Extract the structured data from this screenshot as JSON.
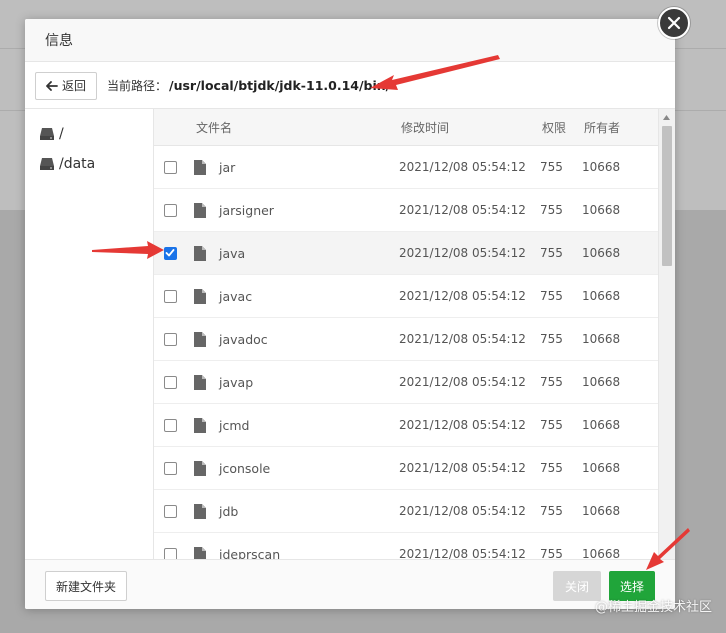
{
  "dialog": {
    "title": "信息"
  },
  "path_bar": {
    "back_label": "返回",
    "current_path_label": "当前路径：",
    "current_path_value": "/usr/local/btjdk/jdk-11.0.14/bin/"
  },
  "sidebar": {
    "drives": [
      {
        "label": "/"
      },
      {
        "label": "/data"
      }
    ]
  },
  "table": {
    "headers": {
      "name": "文件名",
      "modified": "修改时间",
      "permission": "权限",
      "owner": "所有者"
    },
    "rows": [
      {
        "name": "jar",
        "modified": "2021/12/08 05:54:12",
        "permission": "755",
        "owner": "10668",
        "checked": false
      },
      {
        "name": "jarsigner",
        "modified": "2021/12/08 05:54:12",
        "permission": "755",
        "owner": "10668",
        "checked": false
      },
      {
        "name": "java",
        "modified": "2021/12/08 05:54:12",
        "permission": "755",
        "owner": "10668",
        "checked": true
      },
      {
        "name": "javac",
        "modified": "2021/12/08 05:54:12",
        "permission": "755",
        "owner": "10668",
        "checked": false
      },
      {
        "name": "javadoc",
        "modified": "2021/12/08 05:54:12",
        "permission": "755",
        "owner": "10668",
        "checked": false
      },
      {
        "name": "javap",
        "modified": "2021/12/08 05:54:12",
        "permission": "755",
        "owner": "10668",
        "checked": false
      },
      {
        "name": "jcmd",
        "modified": "2021/12/08 05:54:12",
        "permission": "755",
        "owner": "10668",
        "checked": false
      },
      {
        "name": "jconsole",
        "modified": "2021/12/08 05:54:12",
        "permission": "755",
        "owner": "10668",
        "checked": false
      },
      {
        "name": "jdb",
        "modified": "2021/12/08 05:54:12",
        "permission": "755",
        "owner": "10668",
        "checked": false
      },
      {
        "name": "jdeprscan",
        "modified": "2021/12/08 05:54:12",
        "permission": "755",
        "owner": "10668",
        "checked": false
      }
    ]
  },
  "footer": {
    "new_folder_label": "新建文件夹",
    "close_label": "关闭",
    "select_label": "选择"
  },
  "watermark": "@稀土掘金技术社区",
  "colors": {
    "select_button": "#20a53a",
    "close_button": "#d6d6d6",
    "checkbox_checked": "#1a73e8",
    "annotation_arrow": "#e53935"
  },
  "icons": {
    "close": "close-icon",
    "back": "back-arrow-icon",
    "drive": "drive-icon",
    "file": "file-icon"
  }
}
